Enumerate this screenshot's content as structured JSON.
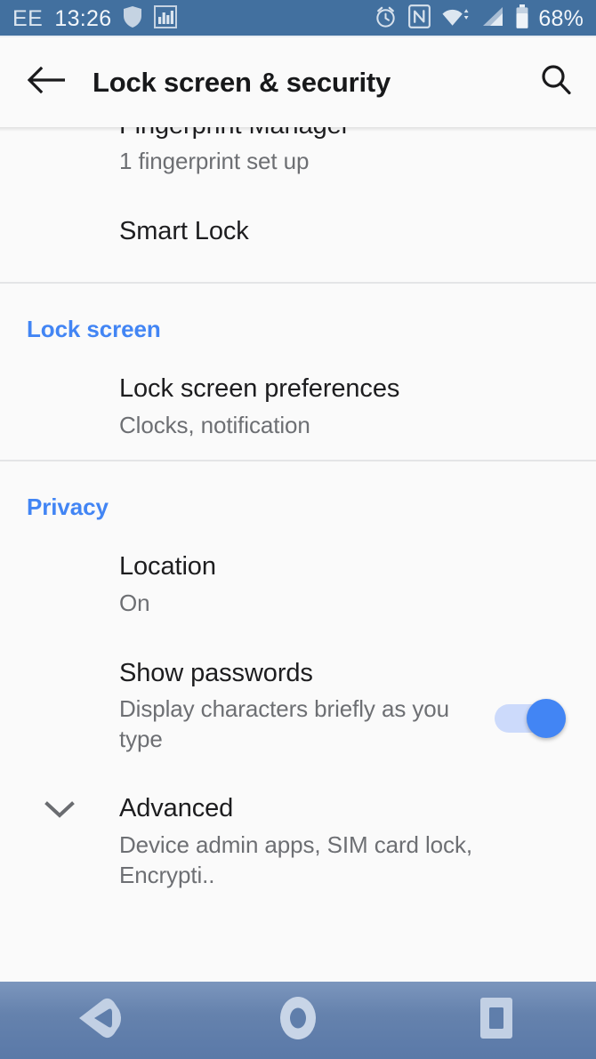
{
  "status_bar": {
    "carrier": "EE",
    "clock": "13:26",
    "battery_percent": "68%",
    "left_icons": [
      "shield-icon",
      "equalizer-icon"
    ],
    "right_icons": [
      "alarm-clock-icon",
      "nfc-icon",
      "wifi-icon",
      "cellular-signal-icon",
      "battery-icon"
    ],
    "background_color": "#42709f"
  },
  "app_bar": {
    "back_label": "Back",
    "title": "Lock screen & security",
    "search_label": "Search"
  },
  "accent_color": "#4285f4",
  "list": [
    {
      "name": "fingerprint-manager",
      "title": "Fingerprint Manager",
      "subtitle": "1 fingerprint set up",
      "widget": "none"
    },
    {
      "name": "smart-lock",
      "title": "Smart Lock",
      "subtitle": "",
      "widget": "none"
    }
  ],
  "sections": [
    {
      "header": "Lock screen",
      "rows": [
        {
          "name": "lock-screen-preferences",
          "title": "Lock screen preferences",
          "subtitle": "Clocks, notification",
          "widget": "none"
        }
      ]
    },
    {
      "header": "Privacy",
      "rows": [
        {
          "name": "location",
          "title": "Location",
          "subtitle": "On",
          "widget": "none"
        },
        {
          "name": "show-passwords",
          "title": "Show passwords",
          "subtitle": "Display characters briefly as you type",
          "widget": "switch",
          "switch_on": true
        },
        {
          "name": "advanced",
          "title": "Advanced",
          "subtitle": "Device admin apps, SIM card lock, Encrypti..",
          "widget": "none",
          "leading_icon": "chevron-down-icon"
        }
      ]
    }
  ],
  "nav_bar": {
    "back_label": "Back",
    "home_label": "Home",
    "recents_label": "Recent apps"
  }
}
